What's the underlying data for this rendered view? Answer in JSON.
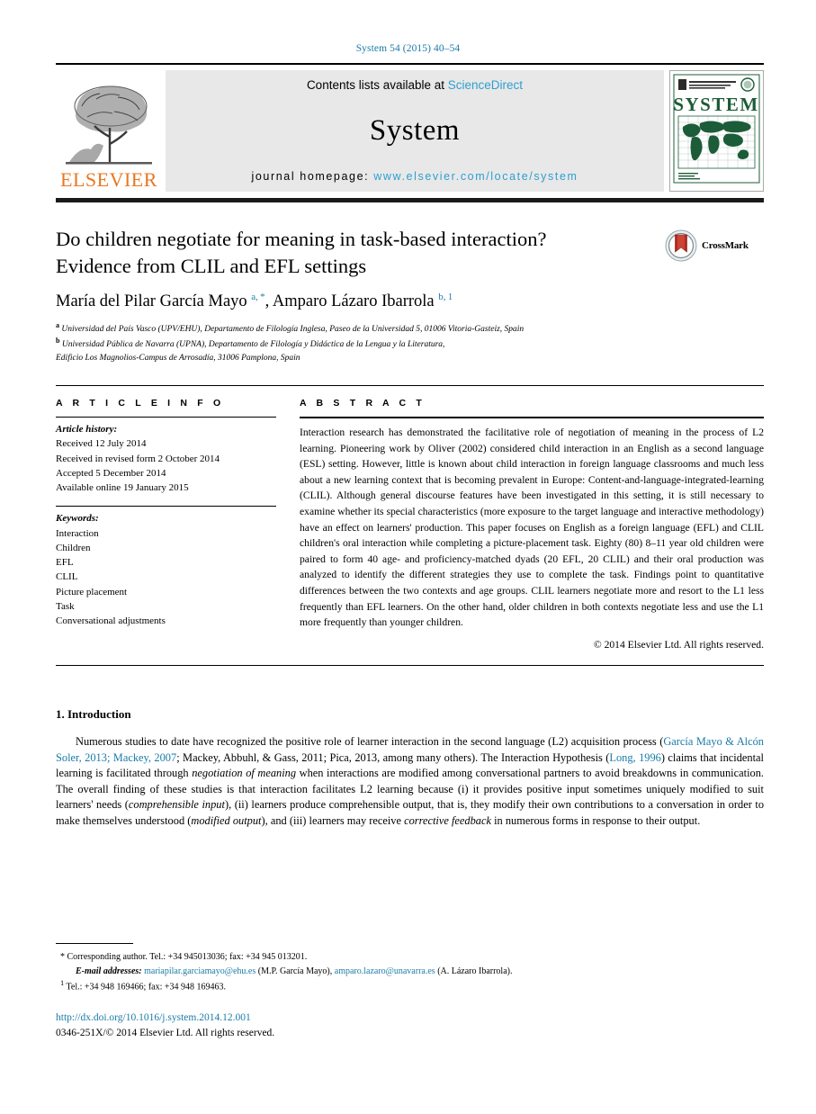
{
  "running_head": "System 54 (2015) 40–54",
  "masthead": {
    "contents_prefix": "Contents lists available at ",
    "sciencedirect": "ScienceDirect",
    "journal_name": "System",
    "homepage_prefix": "journal homepage: ",
    "homepage_url": "www.elsevier.com/locate/system",
    "publisher": "ELSEVIER",
    "cover_title": "SYSTEM"
  },
  "article": {
    "title_line1": "Do children negotiate for meaning in task-based interaction?",
    "title_line2": "Evidence from CLIL and EFL settings",
    "crossmark_label": "CrossMark",
    "authors_html": "María del Pilar García Mayo <sup>a, *</sup>, Amparo Lázaro Ibarrola <sup>b, 1</sup>",
    "affiliation_a": "Universidad del País Vasco (UPV/EHU), Departamento de Filología Inglesa, Paseo de la Universidad 5, 01006 Vitoria-Gasteiz, Spain",
    "affiliation_b_line1": "Universidad Pública de Navarra (UPNA), Departamento de Filología y Didáctica de la Lengua y la Literatura,",
    "affiliation_b_line2": "Edificio Los Magnolios-Campus de Arrosadía, 31006 Pamplona, Spain"
  },
  "article_info": {
    "heading": "A R T I C L E   I N F O",
    "history_label": "Article history:",
    "history": [
      "Received 12 July 2014",
      "Received in revised form 2 October 2014",
      "Accepted 5 December 2014",
      "Available online 19 January 2015"
    ],
    "keywords_label": "Keywords:",
    "keywords": [
      "Interaction",
      "Children",
      "EFL",
      "CLIL",
      "Picture placement",
      "Task",
      "Conversational adjustments"
    ]
  },
  "abstract": {
    "heading": "A B S T R A C T",
    "text": "Interaction research has demonstrated the facilitative role of negotiation of meaning in the process of L2 learning. Pioneering work by Oliver (2002) considered child interaction in an English as a second language (ESL) setting. However, little is known about child interaction in foreign language classrooms and much less about a new learning context that is becoming prevalent in Europe: Content-and-language-integrated-learning (CLIL). Although general discourse features have been investigated in this setting, it is still necessary to examine whether its special characteristics (more exposure to the target language and interactive methodology) have an effect on learners' production. This paper focuses on English as a foreign language (EFL) and CLIL children's oral interaction while completing a picture-placement task. Eighty (80) 8–11 year old children were paired to form 40 age- and proficiency-matched dyads (20 EFL, 20 CLIL) and their oral production was analyzed to identify the different strategies they use to complete the task. Findings point to quantitative differences between the two contexts and age groups. CLIL learners negotiate more and resort to the L1 less frequently than EFL learners. On the other hand, older children in both contexts negotiate less and use the L1 more frequently than younger children.",
    "copyright": "© 2014 Elsevier Ltd. All rights reserved."
  },
  "introduction": {
    "heading": "1. Introduction",
    "paragraph_html": "Numerous studies to date have recognized the positive role of learner interaction in the second language (L2) acquisition process (<span class=\"lnk\">García Mayo &amp; Alcón Soler, 2013; Mackey, 2007</span>; Mackey, Abbuhl, &amp; Gass, 2011; Pica, 2013, among many others). The Interaction Hypothesis (<span class=\"lnk\">Long, 1996</span>) claims that incidental learning is facilitated through <span class=\"em\">negotiation of meaning</span> when interactions are modified among conversational partners to avoid breakdowns in communication. The overall finding of these studies is that interaction facilitates L2 learning because (i) it provides positive input sometimes uniquely modified to suit learners' needs (<span class=\"em\">comprehensible input</span>), (ii) learners produce comprehensible output, that is, they modify their own contributions to a conversation in order to make themselves understood (<span class=\"em\">modified output</span>), and (iii) learners may receive <span class=\"em\">corrective feedback</span> in numerous forms in response to their output."
  },
  "footnotes": {
    "corresponding": "Corresponding author. Tel.: +34 945013036; fax: +34 945 013201.",
    "email_label": "E-mail addresses:",
    "email1": "mariapilar.garciamayo@ehu.es",
    "email1_owner": "(M.P. García Mayo),",
    "email2": "amparo.lazaro@unavarra.es",
    "email2_owner": "(A. Lázaro Ibarrola).",
    "note1": "Tel.: +34 948 169466; fax: +34 948 169463."
  },
  "footer": {
    "doi": "http://dx.doi.org/10.1016/j.system.2014.12.001",
    "issn_copyright": "0346-251X/© 2014 Elsevier Ltd. All rights reserved."
  },
  "colors": {
    "link": "#1a7ba8",
    "sciencedirect": "#2f9fd0",
    "elsevier_orange": "#E87722",
    "cover_green": "#1d5c38"
  }
}
